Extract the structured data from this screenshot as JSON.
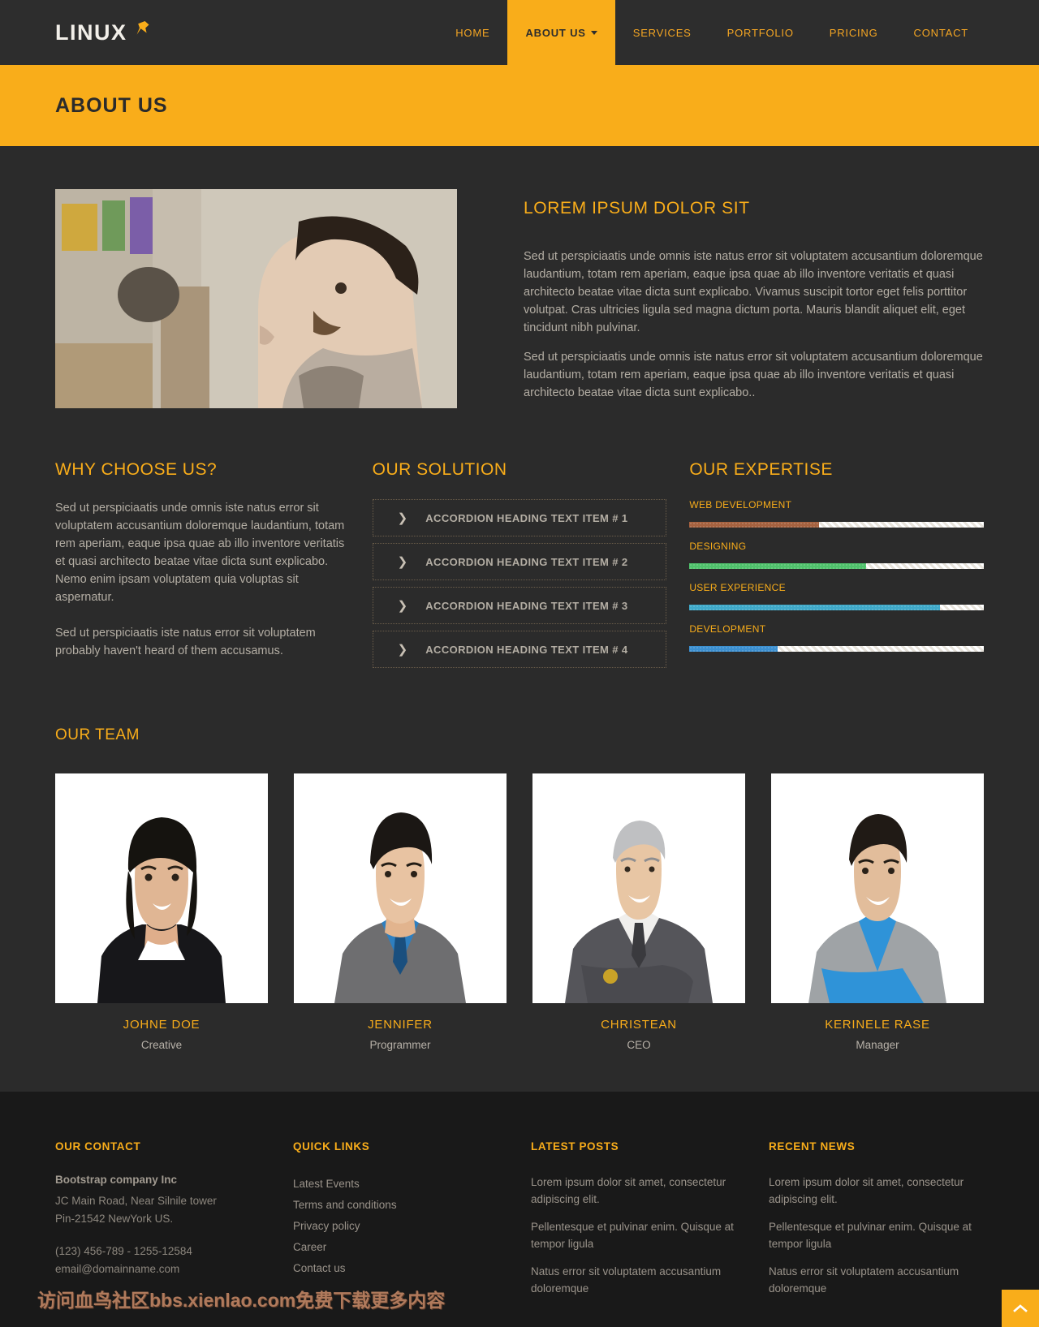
{
  "header": {
    "brand": "LINUX",
    "brand_icon": "pushpin-icon",
    "nav": [
      {
        "label": "HOME",
        "active": false,
        "caret": false
      },
      {
        "label": "ABOUT US",
        "active": true,
        "caret": true
      },
      {
        "label": "SERVICES",
        "active": false,
        "caret": false
      },
      {
        "label": "PORTFOLIO",
        "active": false,
        "caret": false
      },
      {
        "label": "PRICING",
        "active": false,
        "caret": false
      },
      {
        "label": "CONTACT",
        "active": false,
        "caret": false
      }
    ]
  },
  "banner": {
    "title": "ABOUT US"
  },
  "intro": {
    "heading": "LOREM IPSUM DOLOR SIT",
    "paragraph1": "Sed ut perspiciaatis unde omnis iste natus error sit voluptatem accusantium doloremque laudantium, totam rem aperiam, eaque ipsa quae ab illo inventore veritatis et quasi architecto beatae vitae dicta sunt explicabo. Vivamus suscipit tortor eget felis porttitor volutpat. Cras ultricies ligula sed magna dictum porta. Mauris blandit aliquet elit, eget tincidunt nibh pulvinar.",
    "paragraph2": "Sed ut perspiciaatis unde omnis iste natus error sit voluptatem accusantium doloremque laudantium, totam rem aperiam, eaque ipsa quae ab illo inventore veritatis et quasi architecto beatae vitae dicta sunt explicabo.."
  },
  "why_choose": {
    "heading": "WHY CHOOSE US?",
    "paragraph1": "Sed ut perspiciaatis unde omnis iste natus error sit voluptatem accusantium doloremque laudantium, totam rem aperiam, eaque ipsa quae ab illo inventore veritatis et quasi architecto beatae vitae dicta sunt explicabo. Nemo enim ipsam voluptatem quia voluptas sit aspernatur.",
    "paragraph2": "Sed ut perspiciaatis iste natus error sit voluptatem probably haven't heard of them accusamus."
  },
  "our_solution": {
    "heading": "OUR SOLUTION",
    "items": [
      {
        "label": "ACCORDION HEADING TEXT ITEM # 1",
        "icon": "chevron-right-icon"
      },
      {
        "label": "ACCORDION HEADING TEXT ITEM # 2",
        "icon": "chevron-right-icon"
      },
      {
        "label": "ACCORDION HEADING TEXT ITEM # 3",
        "icon": "chevron-right-icon"
      },
      {
        "label": "ACCORDION HEADING TEXT ITEM # 4",
        "icon": "chevron-right-icon"
      }
    ]
  },
  "our_expertise": {
    "heading": "OUR EXPERTISE",
    "skills": [
      {
        "label": "WEB DEVELOPMENT",
        "percent": 44,
        "color": "#a5613f"
      },
      {
        "label": "DESIGNING",
        "percent": 60,
        "color": "#4fc16b"
      },
      {
        "label": "USER EXPERIENCE",
        "percent": 85,
        "color": "#3fa9c9"
      },
      {
        "label": "DEVELOPMENT",
        "percent": 30,
        "color": "#3b8fd0"
      }
    ]
  },
  "our_team": {
    "heading": "OUR TEAM",
    "members": [
      {
        "name": "JOHNE DOE",
        "role": "Creative"
      },
      {
        "name": "JENNIFER",
        "role": "Programmer"
      },
      {
        "name": "CHRISTEAN",
        "role": "CEO"
      },
      {
        "name": "KERINELE RASE",
        "role": "Manager"
      }
    ]
  },
  "footer": {
    "contact": {
      "heading": "OUR CONTACT",
      "company": "Bootstrap company Inc",
      "address_line1": "JC Main Road, Near Silnile tower",
      "address_line2": "Pin-21542 NewYork US.",
      "phone": "(123) 456-789 - 1255-12584",
      "email": "email@domainname.com"
    },
    "quick_links": {
      "heading": "QUICK LINKS",
      "links": [
        "Latest Events",
        "Terms and conditions",
        "Privacy policy",
        "Career",
        "Contact us"
      ]
    },
    "latest_posts": {
      "heading": "LATEST POSTS",
      "posts": [
        "Lorem ipsum dolor sit amet, consectetur adipiscing elit.",
        "Pellentesque et pulvinar enim. Quisque at tempor ligula",
        "Natus error sit voluptatem accusantium doloremque"
      ]
    },
    "recent_news": {
      "heading": "RECENT NEWS",
      "posts": [
        "Lorem ipsum dolor sit amet, consectetur adipiscing elit.",
        "Pellentesque et pulvinar enim. Quisque at tempor ligula",
        "Natus error sit voluptatem accusantium doloremque"
      ]
    },
    "watermark": "访问血鸟社区bbs.xienlao.com免费下载更多内容",
    "scroll_top_icon": "chevron-up-icon"
  },
  "colors": {
    "accent": "#f9ad1a",
    "page_bg": "#2b2b2b",
    "footer_bg": "#191919",
    "body_text": "#b4aea4"
  }
}
